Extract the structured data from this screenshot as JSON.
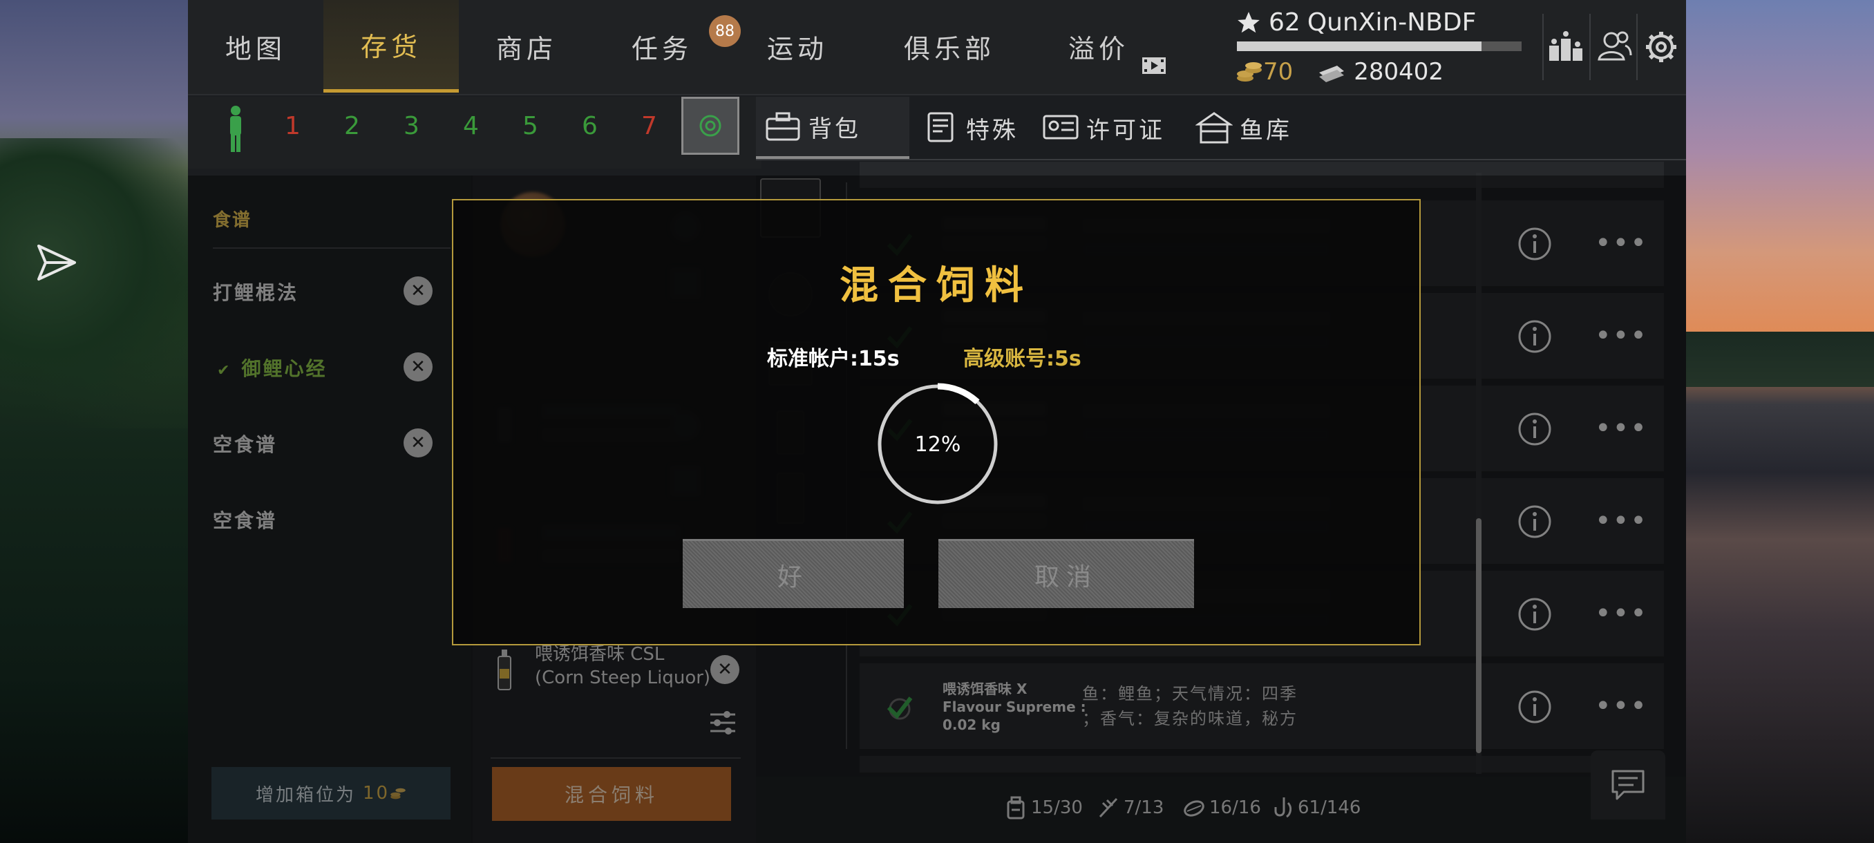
{
  "nav": {
    "tabs": [
      {
        "label": "地图"
      },
      {
        "label": "存货"
      },
      {
        "label": "商店"
      },
      {
        "label": "任务"
      },
      {
        "label": "运动"
      },
      {
        "label": "俱乐部"
      },
      {
        "label": "溢价"
      }
    ],
    "active_tab": "存货",
    "quests_badge": "88"
  },
  "player": {
    "level": "62",
    "name": "QunXin-NBDF",
    "xp_fraction": 0.86,
    "gold": "70",
    "silver": "280402"
  },
  "slots": {
    "numbers": [
      "1",
      "2",
      "3",
      "4",
      "5",
      "6",
      "7"
    ],
    "colors": [
      "#c0392b",
      "#3a9a3a",
      "#3a9a3a",
      "#3a9a3a",
      "#3a9a3a",
      "#3a9a3a",
      "#c0392b"
    ]
  },
  "subtabs": [
    {
      "label": "背包",
      "icon": "backpack-icon"
    },
    {
      "label": "特殊",
      "icon": "special-icon"
    },
    {
      "label": "许可证",
      "icon": "license-icon"
    },
    {
      "label": "鱼库",
      "icon": "fish-storage-icon"
    }
  ],
  "recipes": {
    "header": "食谱",
    "items": [
      {
        "label": "打鲤棍法"
      },
      {
        "label": "御鲤心经"
      },
      {
        "label": "空食谱"
      },
      {
        "label": "空食谱"
      }
    ],
    "add_slot_label": "增加箱位为",
    "add_slot_cost": "10"
  },
  "ingredients": {
    "csl_name_line1": "喂诱饵香味 CSL",
    "csl_name_line2": "(Corn Steep Liquor)",
    "mix_button": "混合饲料"
  },
  "inventory": {
    "last_item": {
      "title_line1": "喂诱饵香味 X",
      "title_line2": "Flavour Supreme :",
      "title_line3": "0.02 kg",
      "desc_line1": "鱼：鲤鱼；天气情况：四季",
      "desc_line2": "；香气：复杂的味道，秘方"
    }
  },
  "status": {
    "bag": "15/30",
    "rods": "7/13",
    "baits": "16/16",
    "tackle": "61/146"
  },
  "dialog": {
    "title": "混合饲料",
    "standard_label": "标准帐户:15s",
    "premium_label": "高级账号:5s",
    "progress_text": "12%",
    "progress_fraction": 0.12,
    "ok_label": "好",
    "cancel_label": "取消"
  },
  "colors": {
    "accent_gold": "#e2bd52",
    "selected_green": "#8ec64a",
    "mix_orange": "#b6672a",
    "dialog_border": "#b59a3c"
  }
}
